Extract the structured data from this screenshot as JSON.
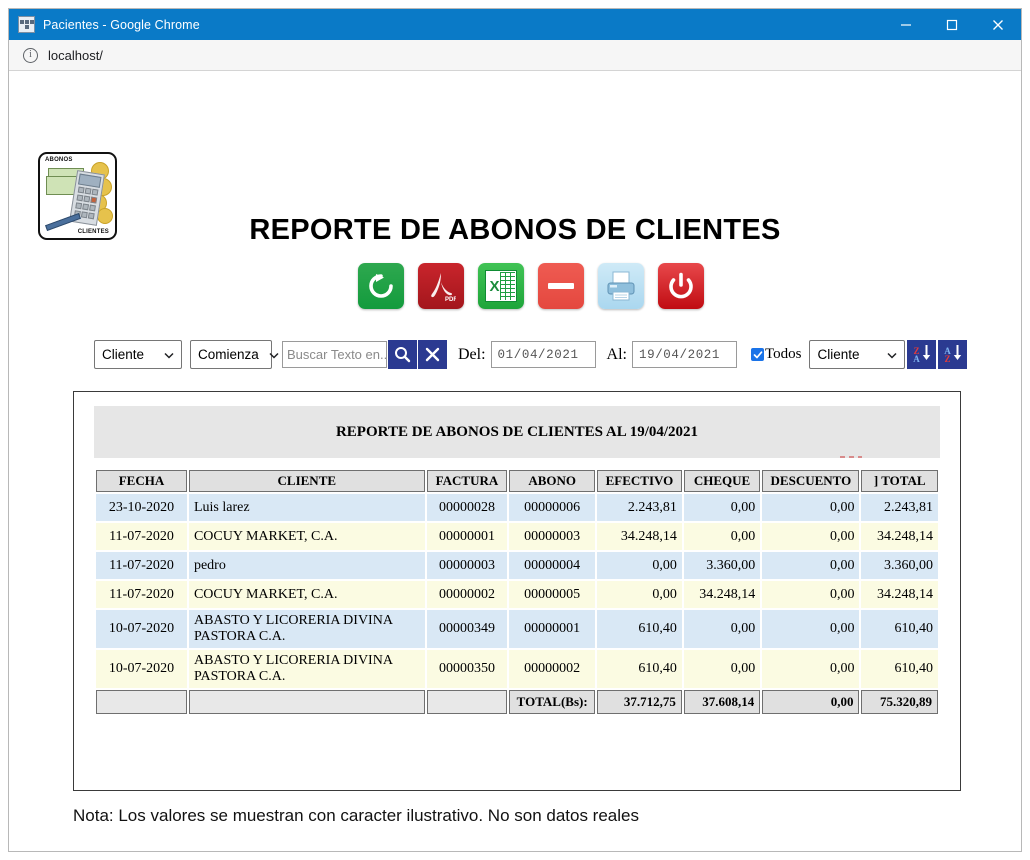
{
  "window": {
    "title": "Pacientes - Google Chrome",
    "favicon_name": "app-favicon",
    "minimize_label": "–",
    "maximize_label": "□",
    "close_label": "✕"
  },
  "address_bar": {
    "info_glyph": "i",
    "url": "localhost/"
  },
  "logo": {
    "top_text": "ABONOS",
    "bottom_text": "CLIENTES"
  },
  "page_title": "REPORTE DE ABONOS DE CLIENTES",
  "toolbar": [
    {
      "name": "refresh-button",
      "label": "Actualizar",
      "color": "#139b3d"
    },
    {
      "name": "pdf-button",
      "label": "PDF",
      "color": "#a3161c"
    },
    {
      "name": "excel-button",
      "label": "Excel",
      "color": "#1ea53a",
      "glyph": "X"
    },
    {
      "name": "minus-button",
      "label": "Quitar",
      "color": "#e4483f"
    },
    {
      "name": "print-button",
      "label": "Imprimir",
      "color": "#aad7ef"
    },
    {
      "name": "exit-button",
      "label": "Salir",
      "color": "#c00c12"
    }
  ],
  "filters": {
    "field_select": {
      "value": "Cliente"
    },
    "condition_select": {
      "value": "Comienza"
    },
    "search_input": {
      "value": "",
      "placeholder": "Buscar Texto en.."
    },
    "search_button_label": "Buscar",
    "clear_button_label": "Limpiar",
    "from_label": "Del:",
    "from_date": "01/04/2021",
    "to_label": "Al:",
    "to_date": "19/04/2021",
    "todos_label": "Todos",
    "todos_checked": true,
    "order_select": {
      "value": "Cliente"
    },
    "sort_desc": {
      "top": "Z",
      "bottom": "A"
    },
    "sort_asc": {
      "top": "A",
      "bottom": "Z"
    }
  },
  "report": {
    "caption": "REPORTE DE ABONOS DE CLIENTES AL 19/04/2021",
    "columns": [
      "FECHA",
      "CLIENTE",
      "FACTURA",
      "ABONO",
      "EFECTIVO",
      "CHEQUE",
      "DESCUENTO",
      "] TOTAL"
    ],
    "rows": [
      {
        "fecha": "23-10-2020",
        "cliente": "Luis larez",
        "factura": "00000028",
        "abono": "00000006",
        "efectivo": "2.243,81",
        "cheque": "0,00",
        "descuento": "0,00",
        "total": "2.243,81"
      },
      {
        "fecha": "11-07-2020",
        "cliente": "COCUY MARKET, C.A.",
        "factura": "00000001",
        "abono": "00000003",
        "efectivo": "34.248,14",
        "cheque": "0,00",
        "descuento": "0,00",
        "total": "34.248,14"
      },
      {
        "fecha": "11-07-2020",
        "cliente": "pedro",
        "factura": "00000003",
        "abono": "00000004",
        "efectivo": "0,00",
        "cheque": "3.360,00",
        "descuento": "0,00",
        "total": "3.360,00"
      },
      {
        "fecha": "11-07-2020",
        "cliente": "COCUY MARKET, C.A.",
        "factura": "00000002",
        "abono": "00000005",
        "efectivo": "0,00",
        "cheque": "34.248,14",
        "descuento": "0,00",
        "total": "34.248,14"
      },
      {
        "fecha": "10-07-2020",
        "cliente": "ABASTO Y LICORERIA DIVINA PASTORA C.A.",
        "factura": "00000349",
        "abono": "00000001",
        "efectivo": "610,40",
        "cheque": "0,00",
        "descuento": "0,00",
        "total": "610,40"
      },
      {
        "fecha": "10-07-2020",
        "cliente": "ABASTO Y LICORERIA DIVINA PASTORA C.A.",
        "factura": "00000350",
        "abono": "00000002",
        "efectivo": "610,40",
        "cheque": "0,00",
        "descuento": "0,00",
        "total": "610,40"
      }
    ],
    "totals": {
      "label": "TOTAL(Bs):",
      "efectivo": "37.712,75",
      "cheque": "37.608,14",
      "descuento": "0,00",
      "total": "75.320,89"
    }
  },
  "note": "Nota: Los valores se muestran con caracter ilustrativo. No son datos reales"
}
